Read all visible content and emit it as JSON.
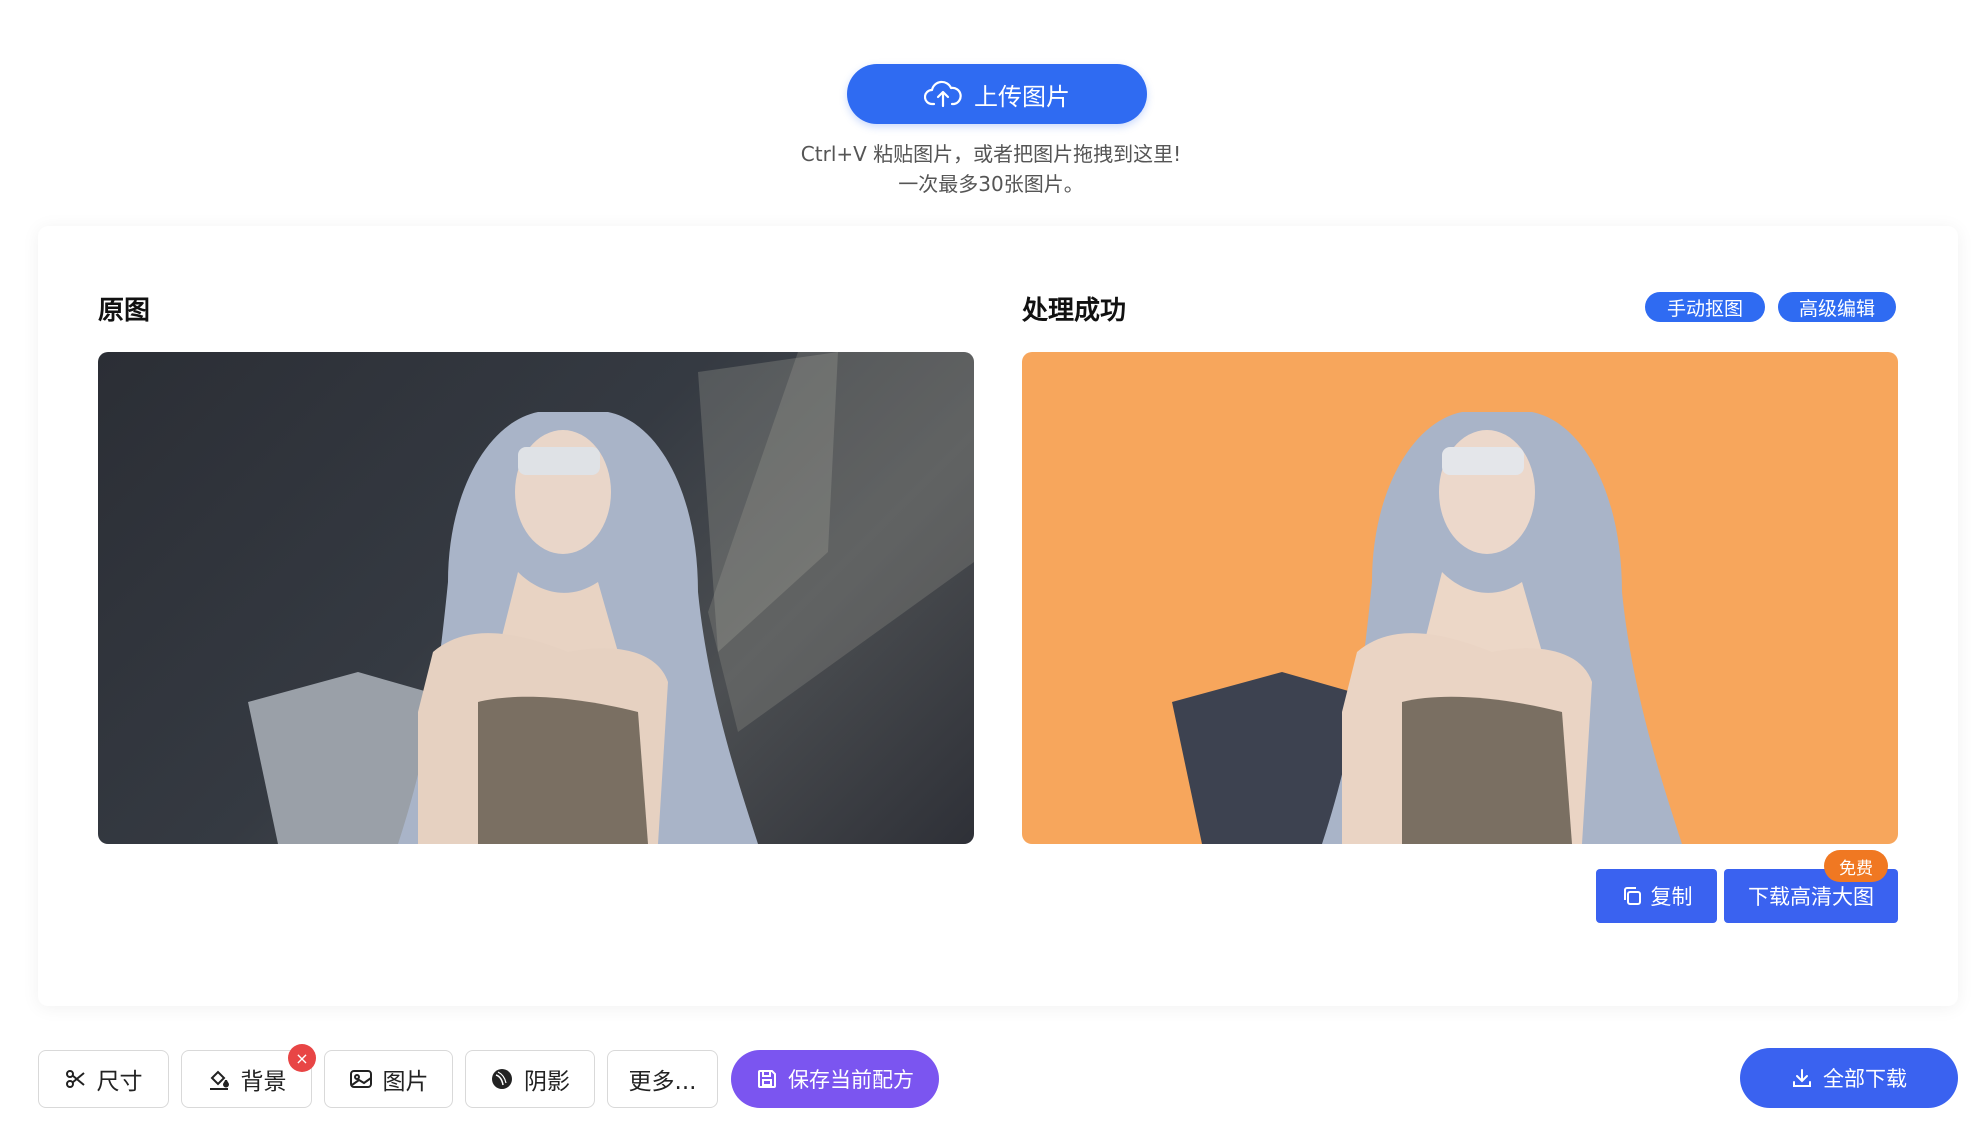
{
  "upload": {
    "button_label": "上传图片",
    "hint_line1": "Ctrl+V 粘贴图片，或者把图片拖拽到这里!",
    "hint_line2": "一次最多30张图片。"
  },
  "panels": {
    "original_title": "原图",
    "result_title": "处理成功",
    "manual_cutout_label": "手动抠图",
    "advanced_edit_label": "高级编辑",
    "result_background_color": "#f7a65c"
  },
  "actions": {
    "copy_label": "复制",
    "download_hd_label": "下载高清大图",
    "free_badge": "免费"
  },
  "toolbar": {
    "size_label": "尺寸",
    "background_label": "背景",
    "background_clear": "×",
    "image_label": "图片",
    "shadow_label": "阴影",
    "more_label": "更多...",
    "save_recipe_label": "保存当前配方",
    "download_all_label": "全部下载"
  },
  "colors": {
    "primary": "#2f6bf2",
    "purple": "#7b55f0",
    "badge_orange": "#f07822",
    "badge_red": "#e84545"
  }
}
